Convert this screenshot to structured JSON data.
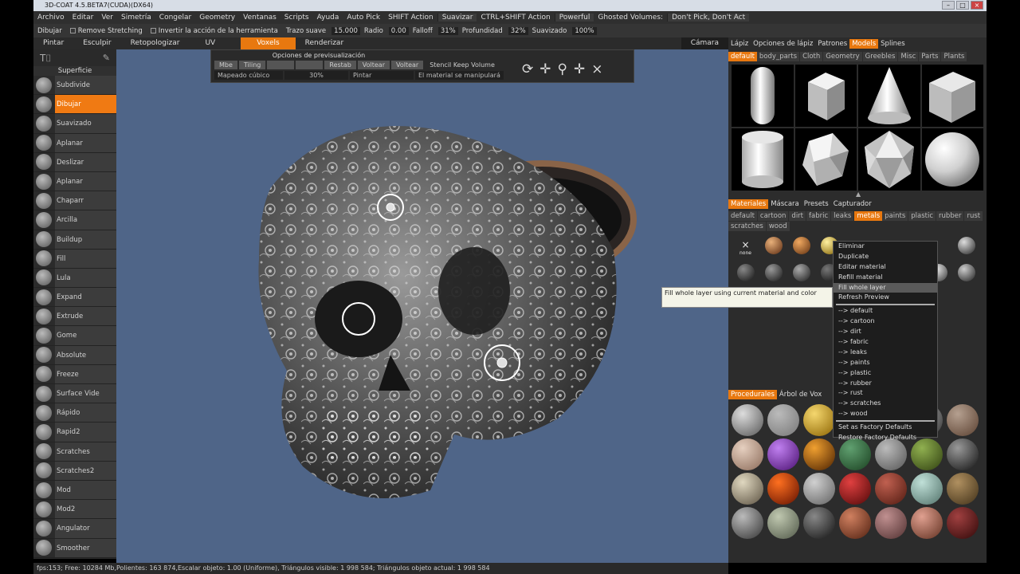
{
  "window": {
    "title": "3D-COAT 4.5.BETA7(CUDA)(DX64)"
  },
  "menu": {
    "items": [
      "Archivo",
      "Editar",
      "Ver",
      "Simetría",
      "Congelar",
      "Geometry",
      "Ventanas",
      "Scripts",
      "Ayuda"
    ],
    "autopick": "Auto Pick",
    "shift_action_label": "SHIFT Action",
    "shift_action_value": "Suavizar",
    "ctrlshift_label": "CTRL+SHIFT Action",
    "ctrlshift_value": "Powerful",
    "ghosted_label": "Ghosted Volumes:",
    "ghosted_value": "Don't Pick, Don't Act"
  },
  "toolbar": {
    "tool_name": "Dibujar",
    "remove_stretching": "Remove Stretching",
    "invert_action": "Invertir la acción de la herramienta",
    "trazo_label": "Trazo suave",
    "trazo_value": "15.000",
    "radio_label": "Radio",
    "radio_value": "0.00",
    "falloff_label": "Falloff",
    "falloff_value": "31%",
    "profundidad_label": "Profundidad",
    "profundidad_value": "32%",
    "suavizado_label": "Suavizado",
    "suavizado_value": "100%"
  },
  "room_tabs": [
    {
      "label": "Pintar",
      "active": false
    },
    {
      "label": "Esculpir",
      "active": false
    },
    {
      "label": "Retopologizar",
      "active": false
    },
    {
      "label": "UV",
      "active": false
    },
    {
      "label": "Voxels",
      "active": true
    },
    {
      "label": "Renderizar",
      "active": false
    }
  ],
  "camera_label": "Cámara",
  "left_panel": {
    "header": "Superficie",
    "tools": [
      "Subdivide",
      "Dibujar",
      "Suavizado",
      "Aplanar",
      "Deslizar",
      "Aplanar",
      "Chaparr",
      "Arcilla",
      "Buildup",
      "Fill",
      "Lula",
      "Expand",
      "Extrude",
      "Gome",
      "Absolute",
      "Freeze",
      "Surface Vide",
      "Rápido",
      "Rapid2",
      "Scratches",
      "Scratches2",
      "Mod",
      "Mod2",
      "Angulator",
      "Smoother"
    ],
    "selected_index": 1
  },
  "preview_panel": {
    "title": "Opciones de previsualización",
    "row1": [
      "Mbe",
      "Tiling",
      "",
      "",
      "Restab",
      "Voltear",
      "Voltear"
    ],
    "stencil_label": "Stencil Keep Volume",
    "row2_mapping": "Mapeado cúbico",
    "row2_pct": "30%",
    "row2_pintar": "Pintar",
    "row2_material": "El material se manipulará",
    "close_label": "close"
  },
  "right_panel": {
    "top_tabs": [
      {
        "label": "Lápiz",
        "active": false
      },
      {
        "label": "Opciones de lápiz",
        "active": false
      },
      {
        "label": "Patrones",
        "active": false
      },
      {
        "label": "Models",
        "active": true
      },
      {
        "label": "Splines",
        "active": false
      }
    ],
    "model_tabs": [
      {
        "label": "default",
        "active": true
      },
      {
        "label": "body_parts",
        "active": false
      },
      {
        "label": "Cloth",
        "active": false
      },
      {
        "label": "Geometry",
        "active": false
      },
      {
        "label": "Greebles",
        "active": false
      },
      {
        "label": "Misc",
        "active": false
      },
      {
        "label": "Parts",
        "active": false
      },
      {
        "label": "Plants",
        "active": false
      }
    ],
    "models": [
      "capsule-model",
      "cube-model",
      "cone-model",
      "rounded-cube-model",
      "cylinder-model",
      "dodecahedron-model",
      "icosahedron-model",
      "sphere-model"
    ],
    "mat_tabs": [
      {
        "label": "Materiales",
        "active": true
      },
      {
        "label": "Máscara",
        "active": false
      },
      {
        "label": "Presets",
        "active": false
      },
      {
        "label": "Capturador",
        "active": false
      }
    ],
    "mat_categories_row1": [
      {
        "label": "default",
        "active": false
      },
      {
        "label": "cartoon",
        "active": false
      },
      {
        "label": "dirt",
        "active": false
      },
      {
        "label": "fabric",
        "active": false
      },
      {
        "label": "leaks",
        "active": false
      },
      {
        "label": "metals",
        "active": true
      },
      {
        "label": "paints",
        "active": false
      },
      {
        "label": "plastic",
        "active": false
      },
      {
        "label": "rubber",
        "active": false
      },
      {
        "label": "rust",
        "active": false
      }
    ],
    "mat_categories_row2": [
      "scratches",
      "wood"
    ],
    "none_label": "none",
    "proc_tabs": [
      {
        "label": "Procedurales",
        "active": true
      },
      {
        "label": "Árbol de Vox",
        "active": false
      }
    ]
  },
  "context_menu": {
    "items": [
      "Eliminar",
      "Duplicate",
      "Editar material",
      "Refill material",
      "Fill whole layer",
      "Refresh Preview"
    ],
    "highlighted_index": 4,
    "sub_items": [
      "--> default",
      "--> cartoon",
      "--> dirt",
      "--> fabric",
      "--> leaks",
      "--> paints",
      "--> plastic",
      "--> rubber",
      "--> rust",
      "--> scratches",
      "--> wood"
    ],
    "footer_items": [
      "Set as Factory Defaults",
      "Restore Factory Defaults"
    ]
  },
  "tooltip": {
    "text": "Fill whole layer using current material and color"
  },
  "status_bar": {
    "text": "fps:153; Free: 10284 Mb,Polientes: 163 874,Escalar objeto: 1.00 (Uniforme), Triángulos visible: 1 998 584; Triángulos objeto actual: 1 998 584"
  },
  "colors": {
    "accent": "#e8780f",
    "viewport_bg": "#4f6588",
    "panel_bg": "#2c2c2c"
  }
}
